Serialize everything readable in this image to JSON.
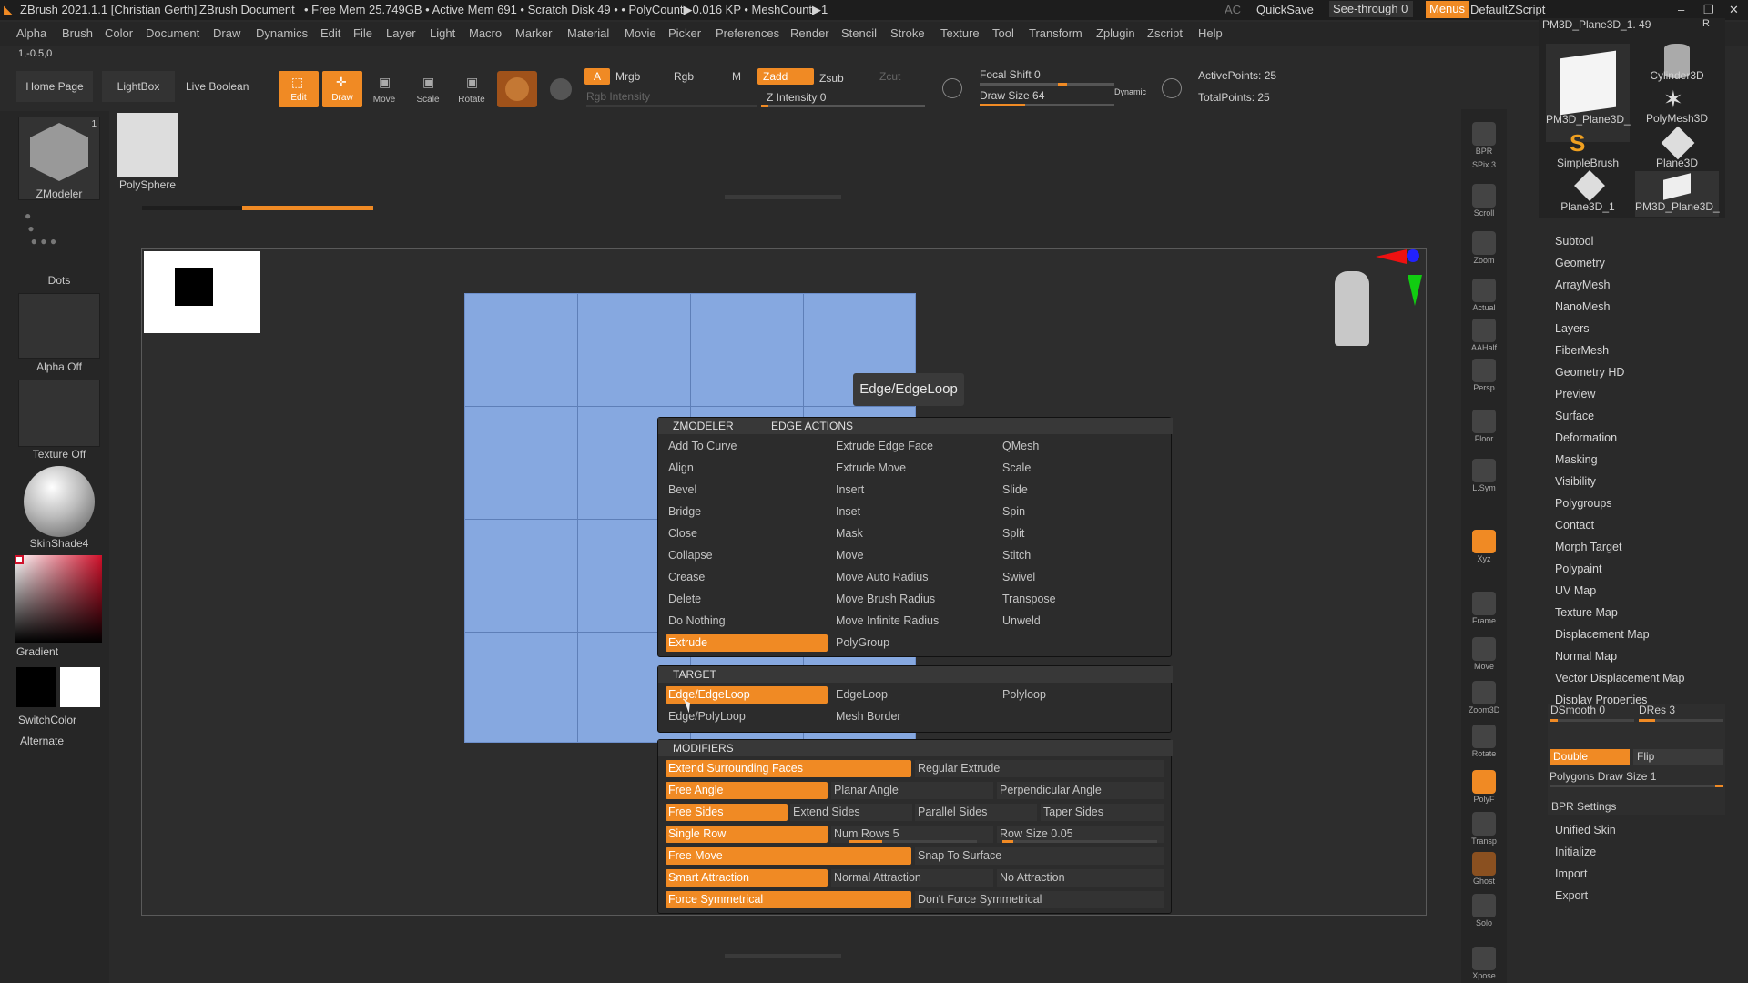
{
  "titlebar": {
    "app": "ZBrush 2021.1.1 [Christian Gerth]",
    "document": "ZBrush Document",
    "stats": "• Free Mem 25.749GB • Active Mem 691 • Scratch Disk 49 • • PolyCount▶0.016 KP • MeshCount▶1",
    "ac": "AC",
    "quicksave": "QuickSave",
    "see_through": "See-through  0",
    "menus": "Menus",
    "zscript": "DefaultZScript"
  },
  "menubar": [
    "Alpha",
    "Brush",
    "Color",
    "Document",
    "Draw",
    "Dynamics",
    "Edit",
    "File",
    "Layer",
    "Light",
    "Macro",
    "Marker",
    "Material",
    "Movie",
    "Picker",
    "Preferences",
    "Render",
    "Stencil",
    "Stroke",
    "Texture",
    "Tool",
    "Transform",
    "Zplugin",
    "Zscript",
    "Help"
  ],
  "coords": "1,-0.5,0",
  "shelf": {
    "home": "Home Page",
    "lightbox": "LightBox",
    "live_boolean": "Live Boolean",
    "edit": "Edit",
    "draw": "Draw",
    "move": "Move",
    "scale": "Scale",
    "rotate": "Rotate",
    "a": "A",
    "mrgb": "Mrgb",
    "rgb": "Rgb",
    "m": "M",
    "zadd": "Zadd",
    "zsub": "Zsub",
    "zcut": "Zcut",
    "rgb_intensity": "Rgb Intensity",
    "z_intensity": "Z Intensity 0",
    "focal_shift": "Focal Shift 0",
    "draw_size": "Draw Size 64",
    "dynamic": "Dynamic",
    "active_points": "ActivePoints: 25",
    "total_points": "TotalPoints: 25"
  },
  "left": {
    "brush": "ZModeler",
    "brush_count": "1",
    "tool": "PolySphere",
    "stroke": "Dots",
    "alpha": "Alpha Off",
    "texture": "Texture Off",
    "material": "SkinShade4",
    "gradient": "Gradient",
    "switchcolor": "SwitchColor",
    "alternate": "Alternate"
  },
  "tooltip": "Edge/EdgeLoop",
  "menu": {
    "head_left": "ZMODELER",
    "head_right": "EDGE ACTIONS",
    "col1": [
      "Add To Curve",
      "Align",
      "Bevel",
      "Bridge",
      "Close",
      "Collapse",
      "Crease",
      "Delete",
      "Do Nothing"
    ],
    "col1_selected": "Extrude",
    "col2": [
      "Extrude Edge Face",
      "Extrude Move",
      "Insert",
      "Inset",
      "Mask",
      "Move",
      "Move Auto Radius",
      "Move Brush Radius",
      "Move Infinite Radius",
      "PolyGroup"
    ],
    "col3": [
      "QMesh",
      "Scale",
      "Slide",
      "Spin",
      "Split",
      "Stitch",
      "Swivel",
      "Transpose",
      "Unweld"
    ],
    "target_head": "TARGET",
    "target_selected": "Edge/EdgeLoop",
    "target_items": [
      "EdgeLoop",
      "Polyloop",
      "Edge/PolyLoop",
      "Mesh Border"
    ],
    "modifiers_head": "MODIFIERS",
    "mod": {
      "r1a": "Extend Surrounding Faces",
      "r1b": "Regular Extrude",
      "r2a": "Free Angle",
      "r2b": "Planar Angle",
      "r2c": "Perpendicular Angle",
      "r3a": "Free Sides",
      "r3b": "Extend Sides",
      "r3c": "Parallel Sides",
      "r3d": "Taper Sides",
      "r4a": "Single Row",
      "r4b": "Num Rows 5",
      "r4c": "Row Size 0.05",
      "r5a": "Free Move",
      "r5b": "Snap To Surface",
      "r6a": "Smart Attraction",
      "r6b": "Normal Attraction",
      "r6c": "No Attraction",
      "r7a": "Force Symmetrical",
      "r7b": "Don't Force Symmetrical"
    }
  },
  "rightstrip": [
    "BPR",
    "SPix 3",
    "Scroll",
    "Zoom",
    "Actual",
    "AAHalf",
    "Persp",
    "Floor",
    "L.Sym",
    "",
    "Xyz",
    "",
    "",
    "Frame",
    "Move",
    "Zoom3D",
    "Rotate",
    "PolyF",
    "Transp",
    "Ghost",
    "Solo",
    "Xpose"
  ],
  "tools": {
    "header": "PM3D_Plane3D_1. 49",
    "items": [
      "PM3D_Plane3D_",
      "Cylinder3D",
      "PolyMesh3D",
      "SimpleBrush",
      "Plane3D",
      "Plane3D_1",
      "PM3D_Plane3D_"
    ]
  },
  "toolpanel": [
    "Subtool",
    "Geometry",
    "ArrayMesh",
    "NanoMesh",
    "Layers",
    "FiberMesh",
    "Geometry HD",
    "Preview",
    "Surface",
    "Deformation",
    "Masking",
    "Visibility",
    "Polygroups",
    "Contact",
    "Morph Target",
    "Polypaint",
    "UV Map",
    "Texture Map",
    "Displacement Map",
    "Normal Map",
    "Vector Displacement Map",
    "Display Properties"
  ],
  "display": {
    "dsmooth": "DSmooth 0",
    "dres": "DRes 3",
    "double": "Double",
    "flip": "Flip",
    "pds": "Polygons Draw Size 1",
    "bpr": "BPR Settings"
  },
  "toolpanel_bottom": [
    "Unified Skin",
    "Initialize",
    "Import",
    "Export"
  ],
  "colors": {
    "accent": "#f08a24",
    "mesh": "#86a8e0"
  }
}
